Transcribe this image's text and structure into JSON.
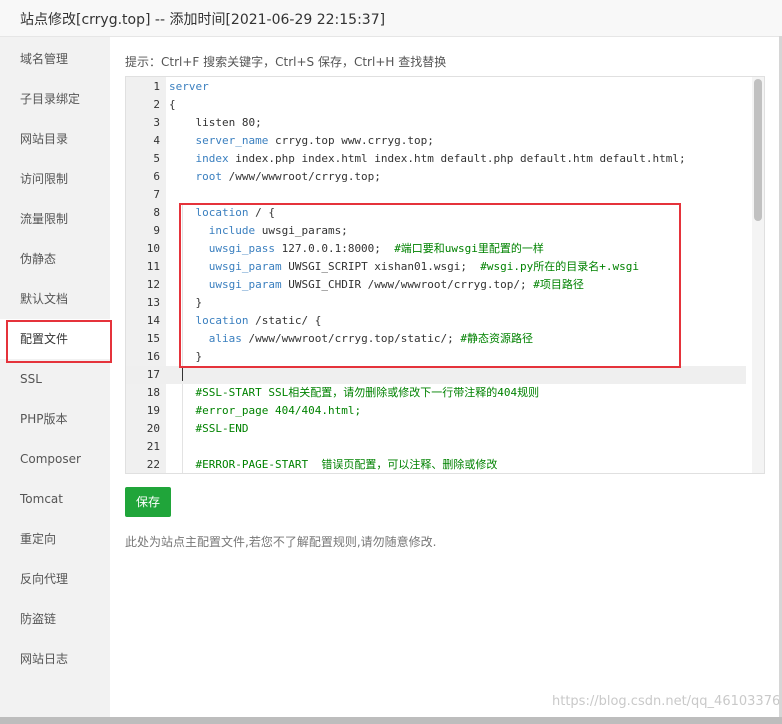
{
  "window": {
    "title": "站点修改[crryg.top] -- 添加时间[2021-06-29 22:15:37]"
  },
  "sidebar": {
    "items": [
      {
        "label": "域名管理"
      },
      {
        "label": "子目录绑定"
      },
      {
        "label": "网站目录"
      },
      {
        "label": "访问限制"
      },
      {
        "label": "流量限制"
      },
      {
        "label": "伪静态"
      },
      {
        "label": "默认文档"
      },
      {
        "label": "配置文件"
      },
      {
        "label": "SSL"
      },
      {
        "label": "PHP版本"
      },
      {
        "label": "Composer"
      },
      {
        "label": "Tomcat"
      },
      {
        "label": "重定向"
      },
      {
        "label": "反向代理"
      },
      {
        "label": "防盗链"
      },
      {
        "label": "网站日志"
      }
    ],
    "active_item": "配置文件"
  },
  "main": {
    "hint": "提示：Ctrl+F 搜索关键字，Ctrl+S 保存，Ctrl+H 查找替换",
    "editor": {
      "lines": [
        {
          "n": "1",
          "kw": "server",
          "rest": "",
          "comment": ""
        },
        {
          "n": "2",
          "kw": "",
          "rest": "{",
          "comment": ""
        },
        {
          "n": "3",
          "kw": "",
          "rest": "    listen 80;",
          "comment": ""
        },
        {
          "n": "4",
          "kw": "    server_name",
          "rest": " crryg.top www.crryg.top;",
          "comment": ""
        },
        {
          "n": "5",
          "kw": "    index",
          "rest": " index.php index.html index.htm default.php default.htm default.html;",
          "comment": ""
        },
        {
          "n": "6",
          "kw": "    root",
          "rest": " /www/wwwroot/crryg.top;",
          "comment": ""
        },
        {
          "n": "7",
          "kw": "",
          "rest": "",
          "comment": ""
        },
        {
          "n": "8",
          "kw": "    location",
          "rest": " / {",
          "comment": ""
        },
        {
          "n": "9",
          "kw": "      include",
          "rest": " uwsgi_params;",
          "comment": ""
        },
        {
          "n": "10",
          "kw": "      uwsgi_pass",
          "rest": " 127.0.0.1:8000;  ",
          "comment": "#端口要和uwsgi里配置的一样"
        },
        {
          "n": "11",
          "kw": "      uwsgi_param",
          "rest": " UWSGI_SCRIPT xishan01.wsgi;  ",
          "comment": "#wsgi.py所在的目录名+.wsgi"
        },
        {
          "n": "12",
          "kw": "      uwsgi_param",
          "rest": " UWSGI_CHDIR /www/wwwroot/crryg.top/; ",
          "comment": "#项目路径"
        },
        {
          "n": "13",
          "kw": "",
          "rest": "    }",
          "comment": ""
        },
        {
          "n": "14",
          "kw": "    location",
          "rest": " /static/ {",
          "comment": ""
        },
        {
          "n": "15",
          "kw": "      alias",
          "rest": " /www/wwwroot/crryg.top/static/; ",
          "comment": "#静态资源路径"
        },
        {
          "n": "16",
          "kw": "",
          "rest": "    }",
          "comment": ""
        },
        {
          "n": "17",
          "kw": "",
          "rest": "",
          "comment": ""
        },
        {
          "n": "18",
          "kw": "",
          "rest": "    ",
          "comment": "#SSL-START SSL相关配置，请勿删除或修改下一行带注释的404规则"
        },
        {
          "n": "19",
          "kw": "",
          "rest": "    ",
          "comment": "#error_page 404/404.html;"
        },
        {
          "n": "20",
          "kw": "",
          "rest": "    ",
          "comment": "#SSL-END"
        },
        {
          "n": "21",
          "kw": "",
          "rest": "",
          "comment": ""
        },
        {
          "n": "22",
          "kw": "",
          "rest": "    ",
          "comment": "#ERROR-PAGE-START  错误页配置，可以注释、删除或修改"
        }
      ],
      "current_line": "17"
    },
    "save_label": "保存",
    "note": "此处为站点主配置文件,若您不了解配置规则,请勿随意修改."
  },
  "watermark": "https://blog.csdn.net/qq_46103376",
  "colors": {
    "accent_green": "#20a53a",
    "highlight_red": "#e5333b",
    "keyword_blue": "#3a7fbf",
    "comment_green": "#008200"
  }
}
